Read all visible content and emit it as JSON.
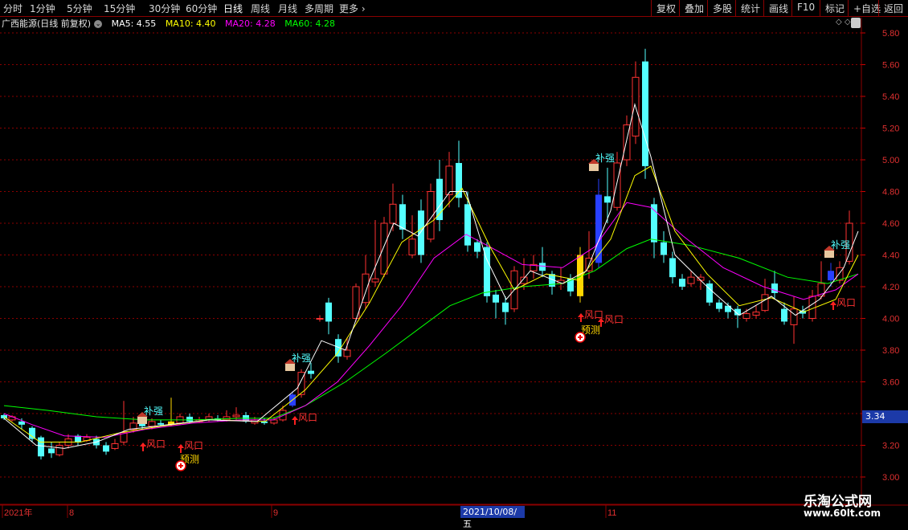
{
  "toolbar": {
    "periods": [
      "分时",
      "1分钟",
      "5分钟",
      "15分钟",
      "30分钟",
      "60分钟",
      "日线",
      "周线",
      "月线",
      "多周期",
      "更多"
    ],
    "active_period": "日线",
    "right_buttons": [
      "复权",
      "叠加",
      "多股",
      "统计",
      "画线",
      "F10",
      "标记",
      "+自选",
      "返回"
    ]
  },
  "legend": {
    "stock": "广西能源(日线 前复权)",
    "ma5": "MA5: 4.55",
    "ma10": "MA10: 4.40",
    "ma20": "MA20: 4.28",
    "ma60": "MA60: 4.28"
  },
  "colors": {
    "up": "#ff3232",
    "down": "#54ffff",
    "ma5": "#ffffff",
    "ma10": "#ffff00",
    "ma20": "#ff00ff",
    "ma60": "#00ff00",
    "grid": "#8b0000"
  },
  "axis": {
    "y_ticks": [
      "5.80",
      "5.60",
      "5.40",
      "5.20",
      "5.00",
      "4.80",
      "4.60",
      "4.40",
      "4.20",
      "4.00",
      "3.80",
      "3.60",
      "3.40",
      "3.20",
      "3.00"
    ],
    "current_price": "3.34",
    "x_labels": [
      "2021年",
      "8",
      "9",
      "2021/10/08/五",
      "11"
    ]
  },
  "annotations": {
    "buqiang": "补强",
    "fengkou": "风口",
    "yuce": "预测"
  },
  "watermark": {
    "line1": "乐淘公式网",
    "line2": "www.60lt.com"
  },
  "chart_data": {
    "type": "candlestick",
    "title": "广西能源(日线 前复权)",
    "ylim": [
      3.0,
      5.8
    ],
    "grid": true,
    "series": [
      {
        "name": "MA5",
        "value": 4.55
      },
      {
        "name": "MA10",
        "value": 4.4
      },
      {
        "name": "MA20",
        "value": 4.28
      },
      {
        "name": "MA60",
        "value": 4.28
      }
    ]
  }
}
